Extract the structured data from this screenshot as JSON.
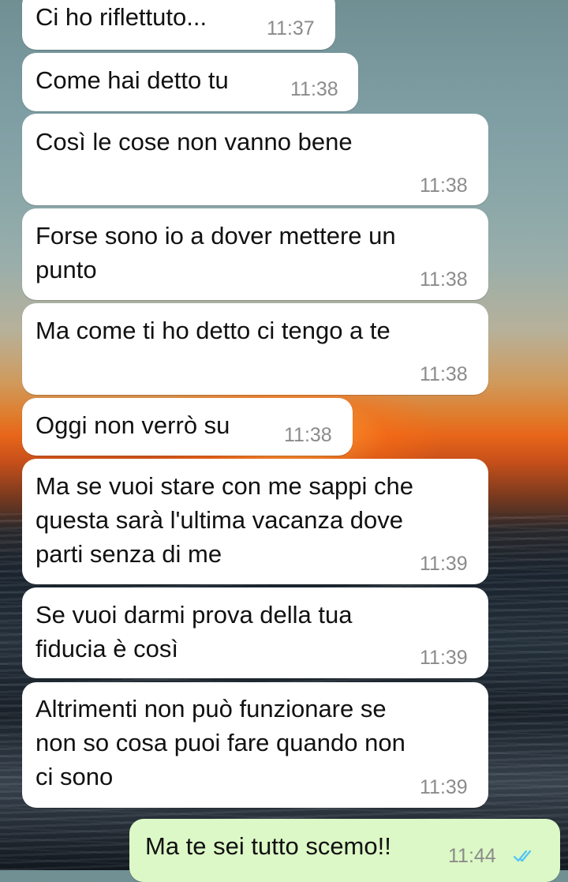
{
  "messages": [
    {
      "text": "Ci ho riflettuto...",
      "time": "11:37",
      "direction": "in"
    },
    {
      "text": "Come hai detto tu",
      "time": "11:38",
      "direction": "in"
    },
    {
      "text": "Così le cose non vanno bene",
      "time": "11:38",
      "direction": "in"
    },
    {
      "text": "Forse sono io a dover mettere un\npunto",
      "time": "11:38",
      "direction": "in"
    },
    {
      "text": "Ma come ti ho detto ci tengo a te",
      "time": "11:38",
      "direction": "in"
    },
    {
      "text": "Oggi non verrò su",
      "time": "11:38",
      "direction": "in"
    },
    {
      "text": "Ma se vuoi stare con me sappi che\nquesta sarà l'ultima vacanza dove\nparti senza di me",
      "time": "11:39",
      "direction": "in"
    },
    {
      "text": "Se vuoi darmi prova della tua\nfiducia è così",
      "time": "11:39",
      "direction": "in"
    },
    {
      "text": "Altrimenti non può funzionare se\nnon so cosa puoi fare quando non\nci sono",
      "time": "11:39",
      "direction": "in"
    },
    {
      "text": "Ma te sei tutto scemo!!",
      "time": "11:44",
      "direction": "out",
      "status": "read",
      "status_icon": "double-check-icon",
      "status_color": "#4fc3f7"
    }
  ],
  "colors": {
    "incoming_bubble": "#ffffff",
    "outgoing_bubble": "#dcf8c6",
    "timestamp": "#8b8b8b",
    "read_ticks": "#4fc3f7"
  }
}
